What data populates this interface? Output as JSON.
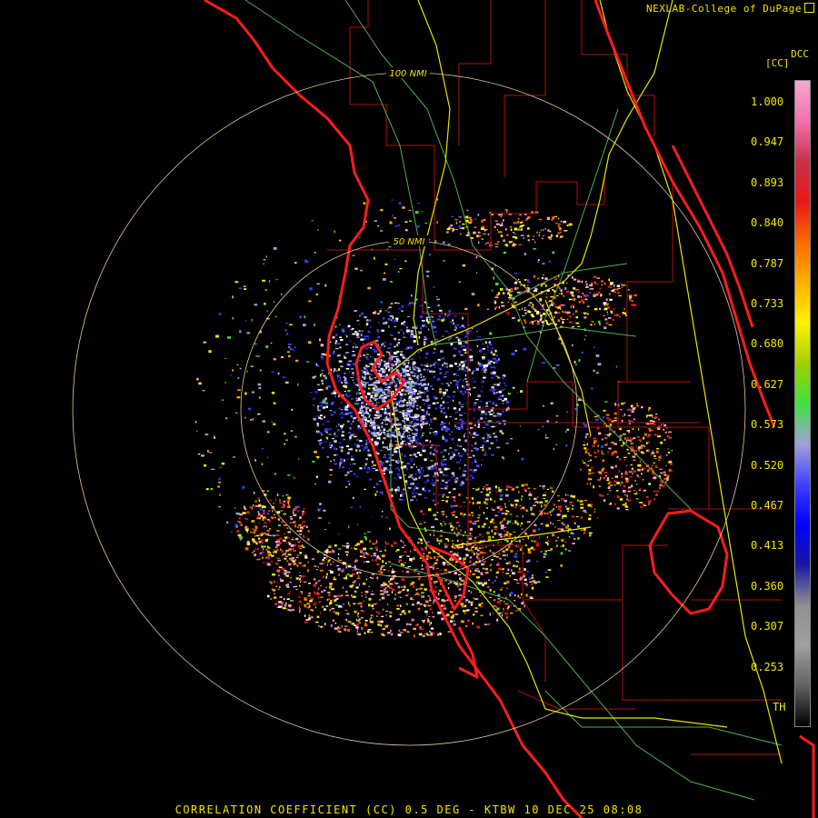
{
  "credit": "NEXLAB-College of DuPage",
  "legend": {
    "product": "DCC",
    "unit": "[CC]",
    "ticks": [
      "1.000",
      "0.947",
      "0.893",
      "0.840",
      "0.787",
      "0.733",
      "0.680",
      "0.627",
      "0.573",
      "0.520",
      "0.467",
      "0.413",
      "0.360",
      "0.307",
      "0.253",
      "TH"
    ],
    "colors": [
      "#f7a8cf",
      "#f070b0",
      "#c8324a",
      "#e81818",
      "#ff6a00",
      "#ffb000",
      "#fff200",
      "#a0d000",
      "#40e040",
      "#a0a0d8",
      "#4040ff",
      "#0000ff",
      "#1818a0",
      "#909090",
      "#a0a0a0",
      "#606060",
      "#000000"
    ]
  },
  "range_rings": [
    "100 NMI",
    "50 NMI"
  ],
  "caption": "CORRELATION COEFFICIENT (CC) 0.5 DEG - KTBW 10 DEC 25 08:08",
  "map_colors": {
    "coast": "#ff1c1c",
    "counties": "#c01010",
    "highways": "#e6e600",
    "roads": "#60c060",
    "rings": "#e8c8a0"
  }
}
